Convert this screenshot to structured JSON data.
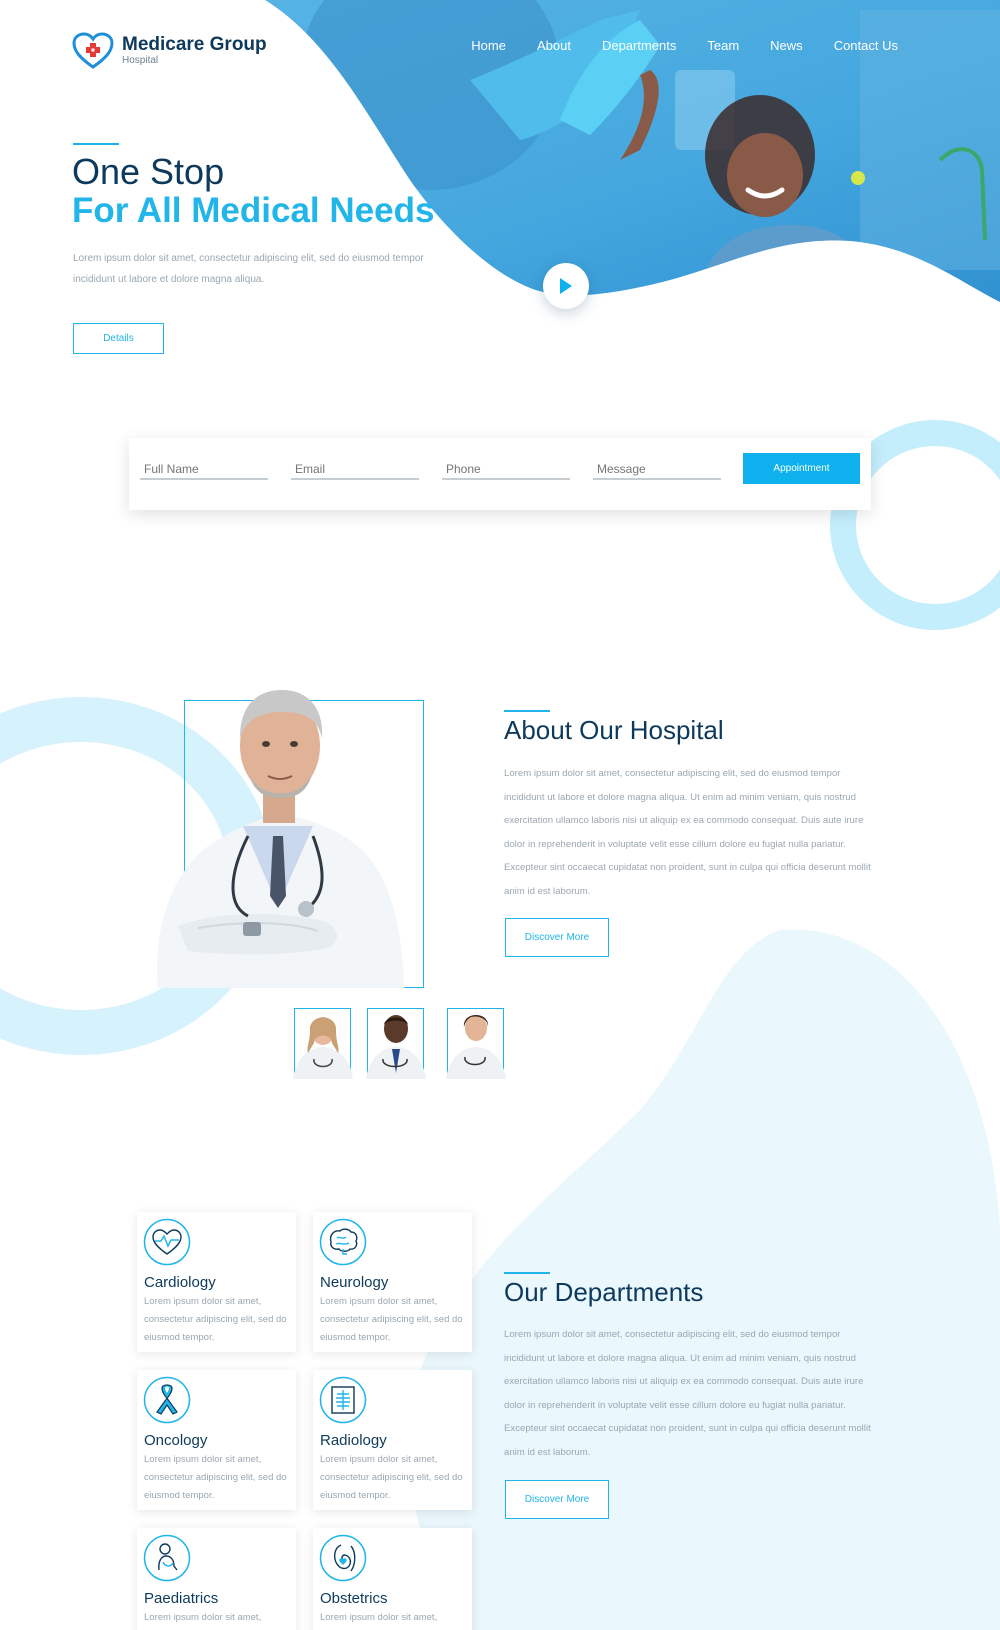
{
  "brand": {
    "name": "Medicare Group",
    "tagline": "Hospital"
  },
  "nav": [
    {
      "label": "Home"
    },
    {
      "label": "About"
    },
    {
      "label": "Departments"
    },
    {
      "label": "Team"
    },
    {
      "label": "News"
    },
    {
      "label": "Contact Us"
    }
  ],
  "hero": {
    "line1": "One Stop",
    "line2": "For All Medical Needs",
    "text": "Lorem ipsum dolor sit amet, consectetur adipiscing elit, sed do eiusmod tempor incididunt ut labore et dolore magna aliqua.",
    "button": "Details"
  },
  "form": {
    "name_placeholder": "Full Name",
    "email_placeholder": "Email",
    "phone_placeholder": "Phone",
    "message_placeholder": "Message",
    "button": "Appointment"
  },
  "about": {
    "title": "About Our Hospital",
    "text": "Lorem ipsum dolor sit amet, consectetur adipiscing elit, sed do eiusmod tempor incididunt ut labore et dolore magna aliqua. Ut enim ad minim veniam, quis nostrud exercitation ullamco laboris nisi ut aliquip ex ea commodo consequat. Duis aute irure dolor in reprehenderit in voluptate velit esse cillum dolore eu fugiat nulla pariatur. Excepteur sint occaecat cupidatat non proident, sunt in culpa qui officia deserunt mollit anim id est laborum.",
    "button": "Discover More"
  },
  "departments": {
    "title": "Our Departments",
    "text": "Lorem ipsum dolor sit amet, consectetur adipiscing elit, sed do eiusmod tempor incididunt ut labore et dolore magna aliqua. Ut enim ad minim veniam, quis nostrud exercitation ullamco laboris nisi ut aliquip ex ea commodo consequat. Duis aute irure dolor in reprehenderit in voluptate velit esse cillum dolore eu fugiat nulla pariatur. Excepteur sint occaecat cupidatat non proident, sunt in culpa qui officia deserunt mollit anim id est laborum.",
    "button": "Discover More",
    "cards": [
      {
        "name": "Cardiology",
        "icon": "heart-pulse-icon",
        "desc": "Lorem ipsum dolor sit amet, consectetur adipiscing elit, sed do eiusmod tempor."
      },
      {
        "name": "Neurology",
        "icon": "brain-icon",
        "desc": "Lorem ipsum dolor sit amet, consectetur adipiscing elit, sed do eiusmod tempor."
      },
      {
        "name": "Oncology",
        "icon": "ribbon-icon",
        "desc": "Lorem ipsum dolor sit amet, consectetur adipiscing elit, sed do eiusmod tempor."
      },
      {
        "name": "Radiology",
        "icon": "xray-icon",
        "desc": "Lorem ipsum dolor sit amet, consectetur adipiscing elit, sed do eiusmod tempor."
      },
      {
        "name": "Paediatrics",
        "icon": "child-icon",
        "desc": "Lorem ipsum dolor sit amet,"
      },
      {
        "name": "Obstetrics",
        "icon": "pregnancy-icon",
        "desc": "Lorem ipsum dolor sit amet,"
      }
    ]
  },
  "colors": {
    "accent": "#21b5ea",
    "navy": "#0d3a5c",
    "muted": "#9aa7b1",
    "light_blue": "#c4eefc"
  }
}
